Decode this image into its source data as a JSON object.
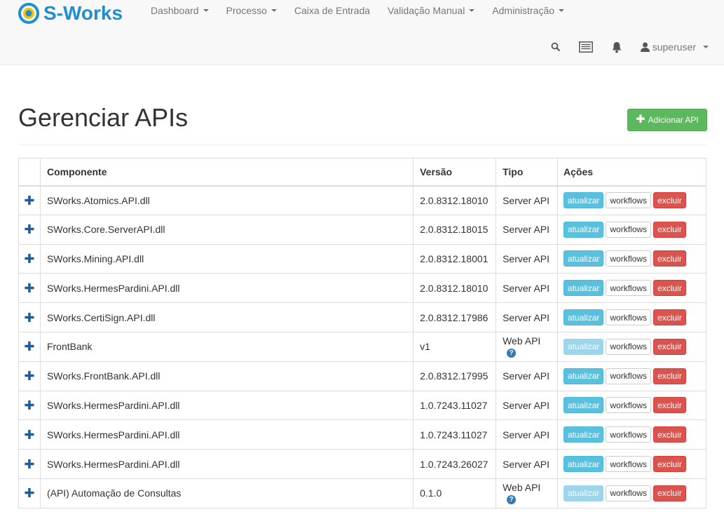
{
  "brand": {
    "name": "S-Works",
    "accent": "#1e8fd0"
  },
  "nav": {
    "items": [
      {
        "label": "Dashboard",
        "dropdown": true
      },
      {
        "label": "Processo",
        "dropdown": true
      },
      {
        "label": "Caixa de Entrada",
        "dropdown": false
      },
      {
        "label": "Validação Manual",
        "dropdown": true
      },
      {
        "label": "Administração",
        "dropdown": true
      }
    ],
    "user": "superuser",
    "icons": [
      "search-icon",
      "list-icon",
      "bell-icon",
      "user-icon"
    ]
  },
  "page": {
    "title": "Gerenciar APIs",
    "add_button": "Adicionar API"
  },
  "table": {
    "headers": {
      "componente": "Componente",
      "versao": "Versão",
      "tipo": "Tipo",
      "acoes": "Ações"
    },
    "actions": {
      "update": "atualizar",
      "workflows": "workflows",
      "delete": "excluir"
    },
    "rows": [
      {
        "componente": "SWorks.Atomics.API.dll",
        "versao": "2.0.8312.18010",
        "tipo": "Server API",
        "web": false
      },
      {
        "componente": "SWorks.Core.ServerAPI.dll",
        "versao": "2.0.8312.18015",
        "tipo": "Server API",
        "web": false
      },
      {
        "componente": "SWorks.Mining.API.dll",
        "versao": "2.0.8312.18001",
        "tipo": "Server API",
        "web": false
      },
      {
        "componente": "SWorks.HermesPardini.API.dll",
        "versao": "2.0.8312.18010",
        "tipo": "Server API",
        "web": false
      },
      {
        "componente": "SWorks.CertiSign.API.dll",
        "versao": "2.0.8312.17986",
        "tipo": "Server API",
        "web": false
      },
      {
        "componente": "FrontBank",
        "versao": "v1",
        "tipo": "Web API",
        "web": true
      },
      {
        "componente": "SWorks.FrontBank.API.dll",
        "versao": "2.0.8312.17995",
        "tipo": "Server API",
        "web": false
      },
      {
        "componente": "SWorks.HermesPardini.API.dll",
        "versao": "1.0.7243.11027",
        "tipo": "Server API",
        "web": false
      },
      {
        "componente": "SWorks.HermesPardini.API.dll",
        "versao": "1.0.7243.11027",
        "tipo": "Server API",
        "web": false
      },
      {
        "componente": "SWorks.HermesPardini.API.dll",
        "versao": "1.0.7243.26027",
        "tipo": "Server API",
        "web": false
      },
      {
        "componente": "(API) Automação de Consultas",
        "versao": "0.1.0",
        "tipo": "Web API",
        "web": true
      }
    ]
  },
  "colors": {
    "success": "#5cb85c",
    "info": "#5bc0de",
    "danger": "#d9534f",
    "primary": "#337ab7"
  }
}
